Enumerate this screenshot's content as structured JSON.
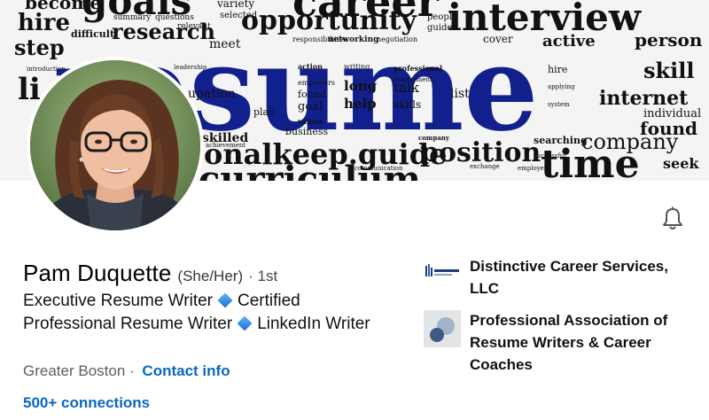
{
  "banner": {
    "main_word": "resume",
    "words": [
      "goals",
      "career",
      "hire",
      "opportunity",
      "interview",
      "research",
      "step",
      "active",
      "person",
      "skill",
      "internet",
      "found",
      "company",
      "time",
      "position",
      "guide",
      "keep",
      "long",
      "help",
      "talk",
      "skills",
      "list",
      "plan",
      "goal",
      "skilled",
      "individual",
      "seek",
      "meet",
      "cover",
      "difficult",
      "people",
      "networking"
    ]
  },
  "profile": {
    "name": "Pam Duquette",
    "pronouns": "(She/Her)",
    "degree": "· 1st",
    "headline": {
      "part1": "Executive Resume Writer",
      "part2": "Certified Professional Resume Writer",
      "part3": "LinkedIn Writer"
    },
    "location": "Greater Boston",
    "separator": "·",
    "contact_label": "Contact info",
    "connections_label": "500+ connections"
  },
  "orgs": [
    {
      "name": "Distinctive Career Services, LLC",
      "logo_icon": "distinctive-logo"
    },
    {
      "name": "Professional Association of Resume Writers & Career Coaches",
      "logo_icon": "parw-logo"
    }
  ],
  "icons": {
    "bell": "bell-icon"
  },
  "colors": {
    "link": "#0a66c2",
    "banner_accent": "#12208e"
  }
}
